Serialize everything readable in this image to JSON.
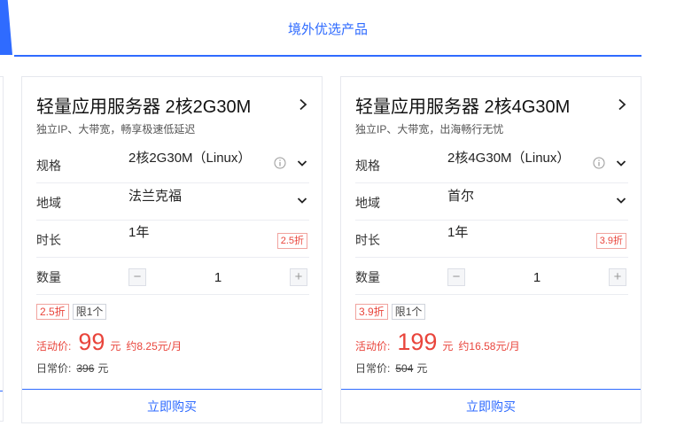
{
  "section": {
    "title": "境外优选产品"
  },
  "colors": {
    "accent": "#2f6bff",
    "price": "#e9453c"
  },
  "labels": {
    "spec": "规格",
    "region": "地域",
    "duration": "时长",
    "quantity": "数量",
    "promo_price": "活动价:",
    "daily_price": "日常价:",
    "yuan": "元",
    "buy": "立即购买"
  },
  "icons": {
    "title_arrow": "chevron-right-icon",
    "info": "info-icon",
    "dropdown": "chevron-down-icon",
    "minus": "minus-icon",
    "plus": "plus-icon"
  },
  "cards": [
    {
      "title": "轻量应用服务器 2核2G30M",
      "subtitle": "独立IP、大带宽，畅享极速低延迟",
      "spec": "2核2G30M（Linux）",
      "region": "法兰克福",
      "duration": "1年",
      "discount": "2.5折",
      "quantity": "1",
      "minus": "−",
      "plus": "+",
      "limit": "限1个",
      "price": "99",
      "per_month": "约8.25元/月",
      "original_price": "396"
    },
    {
      "title": "轻量应用服务器 2核4G30M",
      "subtitle": "独立IP、大带宽，出海畅行无忧",
      "spec": "2核4G30M（Linux）",
      "region": "首尔",
      "duration": "1年",
      "discount": "3.9折",
      "quantity": "1",
      "minus": "−",
      "plus": "+",
      "limit": "限1个",
      "price": "199",
      "per_month": "约16.58元/月",
      "original_price": "504"
    }
  ]
}
